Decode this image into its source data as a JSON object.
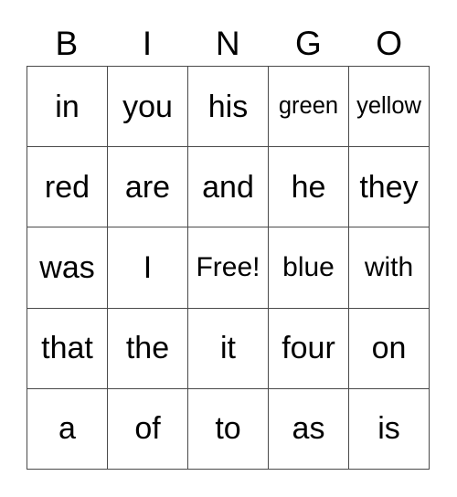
{
  "card": {
    "header_letters": [
      "B",
      "I",
      "N",
      "G",
      "O"
    ],
    "rows": [
      [
        {
          "text": "in",
          "size": "lg"
        },
        {
          "text": "you",
          "size": "lg"
        },
        {
          "text": "his",
          "size": "lg"
        },
        {
          "text": "green",
          "size": "sm"
        },
        {
          "text": "yellow",
          "size": "sm"
        }
      ],
      [
        {
          "text": "red",
          "size": "lg"
        },
        {
          "text": "are",
          "size": "lg"
        },
        {
          "text": "and",
          "size": "lg"
        },
        {
          "text": "he",
          "size": "lg"
        },
        {
          "text": "they",
          "size": "lg"
        }
      ],
      [
        {
          "text": "was",
          "size": "lg"
        },
        {
          "text": "I",
          "size": "lg"
        },
        {
          "text": "Free!",
          "size": "md"
        },
        {
          "text": "blue",
          "size": "md"
        },
        {
          "text": "with",
          "size": "md"
        }
      ],
      [
        {
          "text": "that",
          "size": "lg"
        },
        {
          "text": "the",
          "size": "lg"
        },
        {
          "text": "it",
          "size": "lg"
        },
        {
          "text": "four",
          "size": "lg"
        },
        {
          "text": "on",
          "size": "lg"
        }
      ],
      [
        {
          "text": "a",
          "size": "lg"
        },
        {
          "text": "of",
          "size": "lg"
        },
        {
          "text": "to",
          "size": "lg"
        },
        {
          "text": "as",
          "size": "lg"
        },
        {
          "text": "is",
          "size": "lg"
        }
      ]
    ],
    "colors": {
      "text": "#000000",
      "border": "#4a4a4a",
      "background": "#ffffff"
    }
  }
}
